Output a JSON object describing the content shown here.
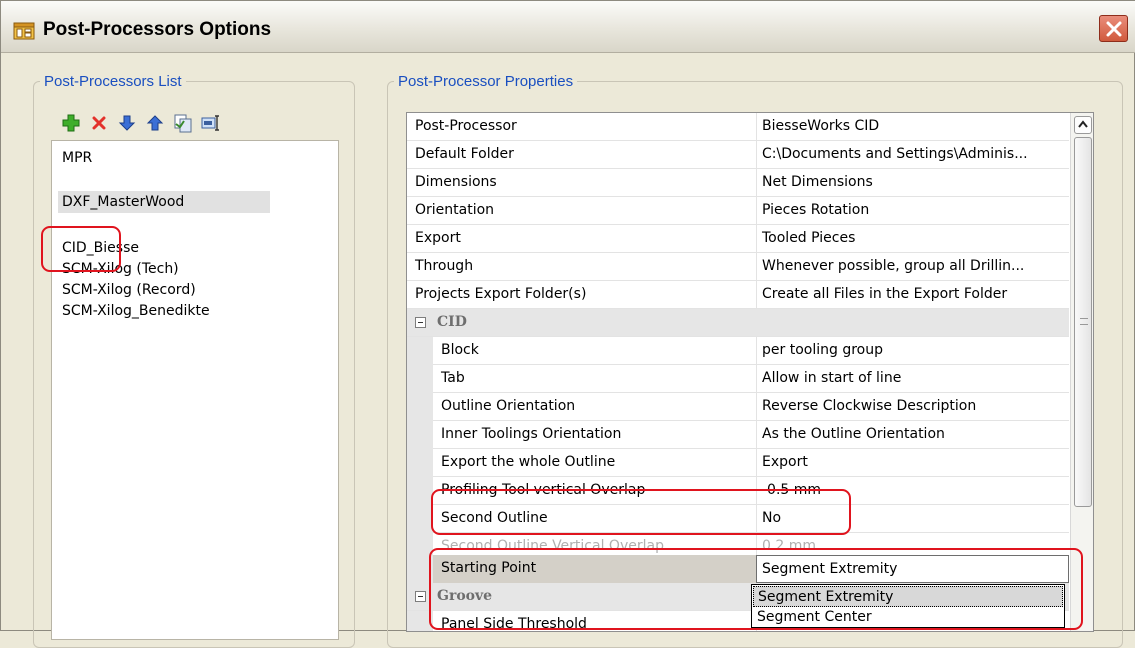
{
  "window": {
    "title": "Post-Processors Options"
  },
  "left_panel": {
    "legend": "Post-Processors List",
    "toolbar": [
      "add-icon",
      "delete-icon",
      "move-down-icon",
      "move-up-icon",
      "copy-icon",
      "rename-icon"
    ],
    "items": [
      {
        "label": "MPR"
      },
      {
        "label": "DXF_MasterWood"
      },
      {
        "label": "CID_Biesse"
      },
      {
        "label": "SCM-Xilog (Tech)"
      },
      {
        "label": "SCM-Xilog (Record)"
      },
      {
        "label": "SCM-Xilog_Benedikte"
      }
    ]
  },
  "right_panel": {
    "legend": "Post-Processor Properties",
    "rows": [
      {
        "name": "Post-Processor",
        "value": "BiesseWorks CID"
      },
      {
        "name": "Default Folder",
        "value": "C:\\Documents and Settings\\Adminis..."
      },
      {
        "name": "Dimensions",
        "value": "Net Dimensions"
      },
      {
        "name": "Orientation",
        "value": "Pieces Rotation"
      },
      {
        "name": "Export",
        "value": "Tooled Pieces"
      },
      {
        "name": "Through",
        "value": "Whenever possible, group all Drillin..."
      },
      {
        "name": "Projects Export Folder(s)",
        "value": "Create all Files in the Export Folder"
      },
      {
        "category": "CID"
      },
      {
        "name": "Block",
        "value": "per tooling group"
      },
      {
        "name": "Tab",
        "value": "Allow in start of line"
      },
      {
        "name": "Outline Orientation",
        "value": "Reverse Clockwise Description"
      },
      {
        "name": "Inner Toolings Orientation",
        "value": "As the Outline Orientation"
      },
      {
        "name": "Export the whole Outline",
        "value": "Export"
      },
      {
        "name": "Profiling Tool vertical Overlap",
        "value": "-0.5 mm"
      },
      {
        "name": "Second Outline",
        "value": "No"
      },
      {
        "name": "Second Outline Vertical Overlap",
        "value": "0.2 mm"
      },
      {
        "name": "Starting Point",
        "value": "Segment Extremity"
      },
      {
        "category": "Groove"
      },
      {
        "name": "Panel Side Threshold",
        "value": ""
      }
    ],
    "dropdown_options": [
      "Segment Extremity",
      "Segment Center"
    ]
  }
}
